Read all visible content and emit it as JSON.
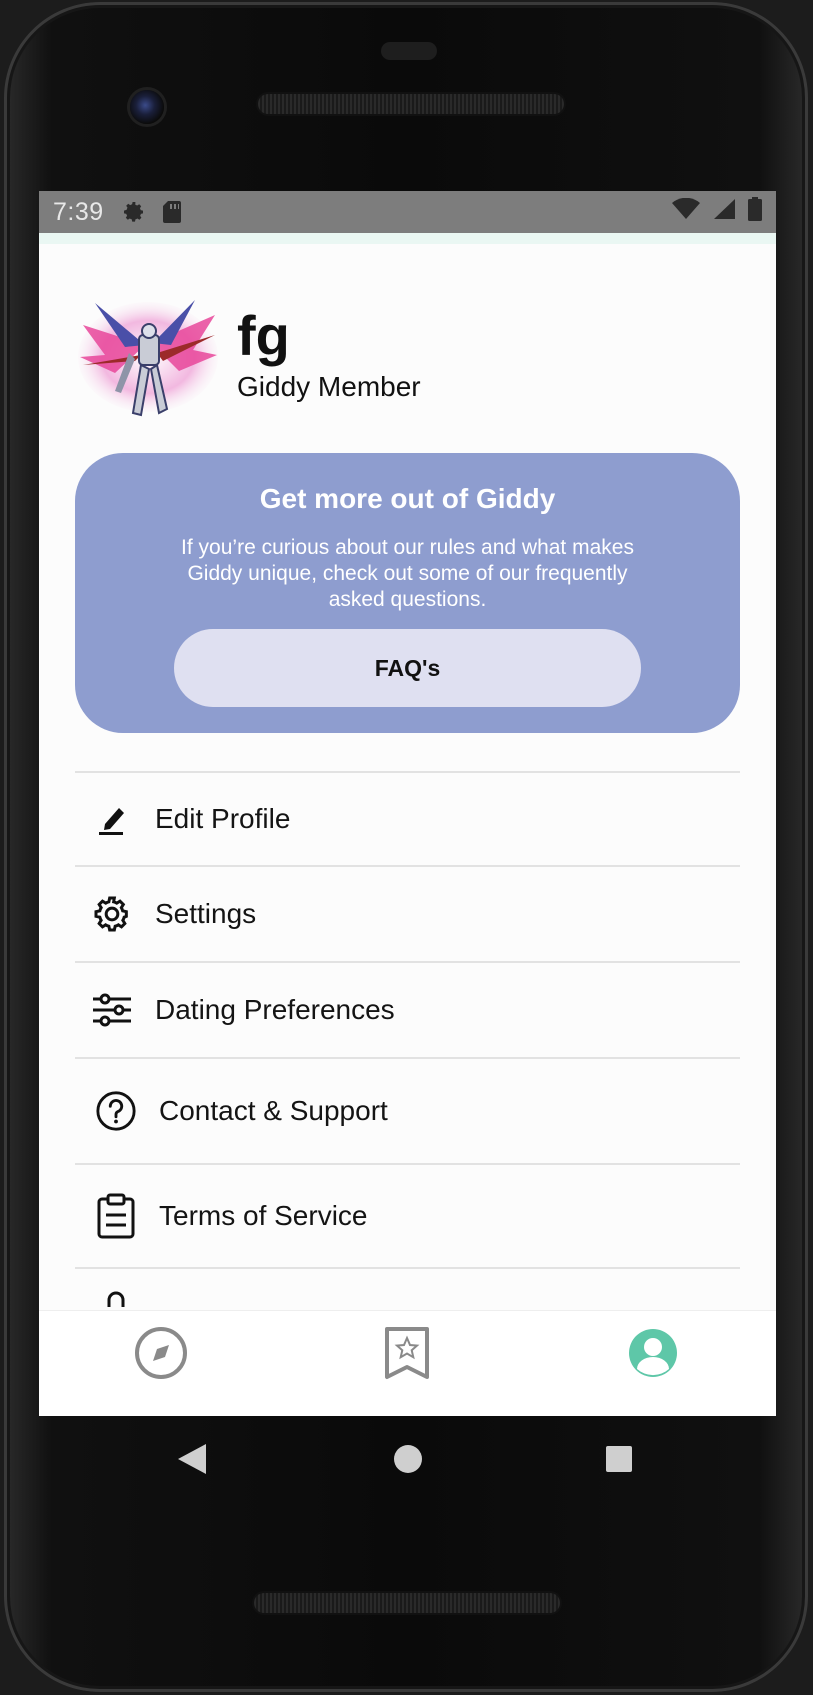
{
  "status_bar": {
    "time": "7:39",
    "icons": [
      "gear-icon",
      "sd-card-icon",
      "wifi-icon",
      "signal-icon",
      "battery-icon"
    ]
  },
  "profile": {
    "name": "fg",
    "role": "Giddy Member",
    "avatar_icon": "mecha-robot-avatar"
  },
  "promo": {
    "title": "Get more out of Giddy",
    "body": "If you’re curious about our rules and what makes Giddy unique, check out some of our frequently asked questions.",
    "button_label": "FAQ's",
    "color": "#8e9dcf",
    "button_color": "#dfe0f1"
  },
  "menu": [
    {
      "label": "Edit Profile",
      "icon": "pencil-icon"
    },
    {
      "label": "Settings",
      "icon": "gear-icon"
    },
    {
      "label": "Dating Preferences",
      "icon": "sliders-icon"
    },
    {
      "label": "Contact & Support",
      "icon": "question-circle-icon"
    },
    {
      "label": "Terms of Service",
      "icon": "clipboard-icon"
    }
  ],
  "bottom_nav": {
    "items": [
      "compass-icon",
      "bookmark-star-icon",
      "profile-icon"
    ],
    "active": "profile-icon",
    "accent": "#5ec7a8"
  },
  "system_nav": [
    "back-icon",
    "home-icon",
    "recents-icon"
  ]
}
